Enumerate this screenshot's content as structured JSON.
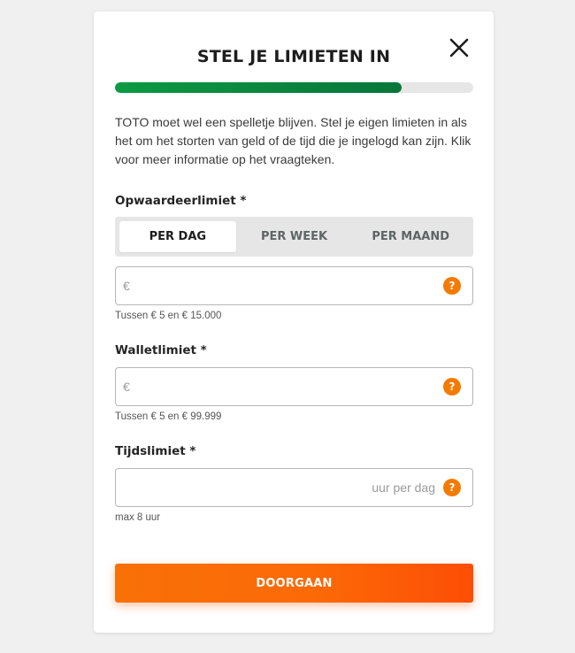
{
  "modal": {
    "title": "STEL JE LIMIETEN IN",
    "close_icon": "close-icon",
    "progress_fraction": 0.8,
    "accent_green": "#0b8a40",
    "accent_orange": "#f57a00",
    "intro": "TOTO moet wel een spelletje blijven. Stel je eigen limieten in als het om het storten van geld of de tijd die je ingelogd kan zijn. Klik voor meer informatie op het vraagteken."
  },
  "deposit": {
    "label": "Opwaardeerlimiet *",
    "tabs": [
      {
        "label": "PER DAG",
        "active": true
      },
      {
        "label": "PER WEEK",
        "active": false
      },
      {
        "label": "PER MAAND",
        "active": false
      }
    ],
    "placeholder": "€",
    "value": "",
    "help_icon": "question-icon",
    "help_glyph": "?",
    "hint": "Tussen € 5 en € 15.000"
  },
  "wallet": {
    "label": "Walletlimiet *",
    "placeholder": "€",
    "value": "",
    "help_icon": "question-icon",
    "help_glyph": "?",
    "hint": "Tussen € 5 en € 99.999"
  },
  "time": {
    "label": "Tijdslimiet *",
    "value": "",
    "suffix": "uur per dag",
    "help_icon": "question-icon",
    "help_glyph": "?",
    "hint": "max 8 uur"
  },
  "cta": {
    "label": "DOORGAAN"
  }
}
